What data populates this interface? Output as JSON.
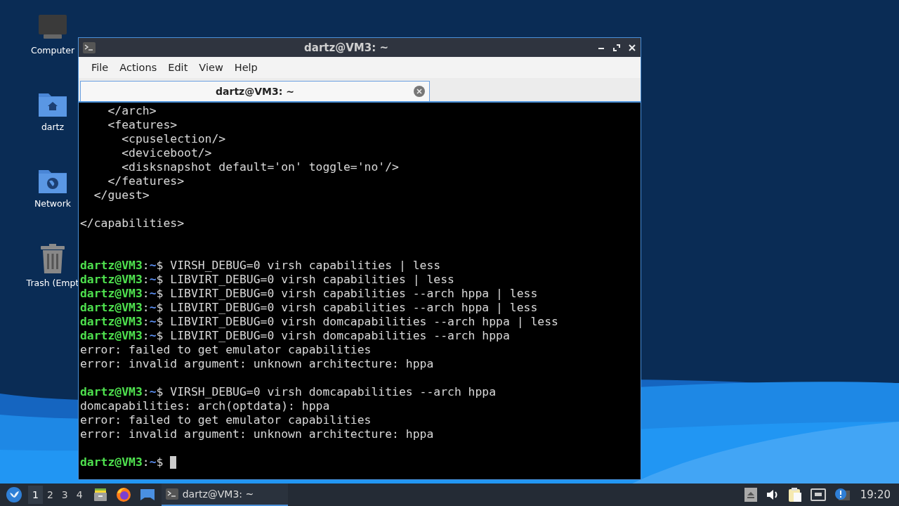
{
  "desktop": {
    "icons": [
      {
        "label": "Computer",
        "kind": "computer"
      },
      {
        "label": "dartz",
        "kind": "home-folder"
      },
      {
        "label": "Network",
        "kind": "network-folder"
      },
      {
        "label": "Trash (Empt",
        "kind": "trash"
      }
    ]
  },
  "window": {
    "title": "dartz@VM3: ~",
    "menu": [
      "File",
      "Actions",
      "Edit",
      "View",
      "Help"
    ],
    "tabs": [
      {
        "label": "dartz@VM3: ~",
        "selected": true
      }
    ],
    "terminal": {
      "lines": [
        {
          "kind": "output",
          "text": "    </arch>"
        },
        {
          "kind": "output",
          "text": "    <features>"
        },
        {
          "kind": "output",
          "text": "      <cpuselection/>"
        },
        {
          "kind": "output",
          "text": "      <deviceboot/>"
        },
        {
          "kind": "output",
          "text": "      <disksnapshot default='on' toggle='no'/>"
        },
        {
          "kind": "output",
          "text": "    </features>"
        },
        {
          "kind": "output",
          "text": "  </guest>"
        },
        {
          "kind": "blank"
        },
        {
          "kind": "output",
          "text": "</capabilities>"
        },
        {
          "kind": "blank"
        },
        {
          "kind": "blank"
        },
        {
          "kind": "prompt",
          "user": "dartz@VM3",
          "sep": ":",
          "path": "~",
          "sigil": "$",
          "command": "VIRSH_DEBUG=0 virsh capabilities | less",
          "cursor": false
        },
        {
          "kind": "prompt",
          "user": "dartz@VM3",
          "sep": ":",
          "path": "~",
          "sigil": "$",
          "command": "LIBVIRT_DEBUG=0 virsh capabilities | less",
          "cursor": false
        },
        {
          "kind": "prompt",
          "user": "dartz@VM3",
          "sep": ":",
          "path": "~",
          "sigil": "$",
          "command": "LIBVIRT_DEBUG=0 virsh capabilities --arch hppa | less",
          "cursor": false
        },
        {
          "kind": "prompt",
          "user": "dartz@VM3",
          "sep": ":",
          "path": "~",
          "sigil": "$",
          "command": "LIBVIRT_DEBUG=0 virsh capabilities --arch hppa | less",
          "cursor": false
        },
        {
          "kind": "prompt",
          "user": "dartz@VM3",
          "sep": ":",
          "path": "~",
          "sigil": "$",
          "command": "LIBVIRT_DEBUG=0 virsh domcapabilities --arch hppa | less",
          "cursor": false
        },
        {
          "kind": "prompt",
          "user": "dartz@VM3",
          "sep": ":",
          "path": "~",
          "sigil": "$",
          "command": "LIBVIRT_DEBUG=0 virsh domcapabilities --arch hppa",
          "cursor": false
        },
        {
          "kind": "output",
          "text": "error: failed to get emulator capabilities"
        },
        {
          "kind": "output",
          "text": "error: invalid argument: unknown architecture: hppa"
        },
        {
          "kind": "blank"
        },
        {
          "kind": "prompt",
          "user": "dartz@VM3",
          "sep": ":",
          "path": "~",
          "sigil": "$",
          "command": "VIRSH_DEBUG=0 virsh domcapabilities --arch hppa",
          "cursor": false
        },
        {
          "kind": "output",
          "text": "domcapabilities: arch(optdata): hppa"
        },
        {
          "kind": "output",
          "text": "error: failed to get emulator capabilities"
        },
        {
          "kind": "output",
          "text": "error: invalid argument: unknown architecture: hppa"
        },
        {
          "kind": "blank"
        },
        {
          "kind": "prompt",
          "user": "dartz@VM3",
          "sep": ":",
          "path": "~",
          "sigil": "$",
          "cursor": true
        }
      ]
    }
  },
  "taskbar": {
    "workspaces": [
      {
        "label": "1",
        "selected": true
      },
      {
        "label": "2",
        "selected": false
      },
      {
        "label": "3",
        "selected": false
      },
      {
        "label": "4",
        "selected": false
      }
    ],
    "task": {
      "label": "dartz@VM3: ~",
      "selected": true
    },
    "clock": "19:20"
  }
}
